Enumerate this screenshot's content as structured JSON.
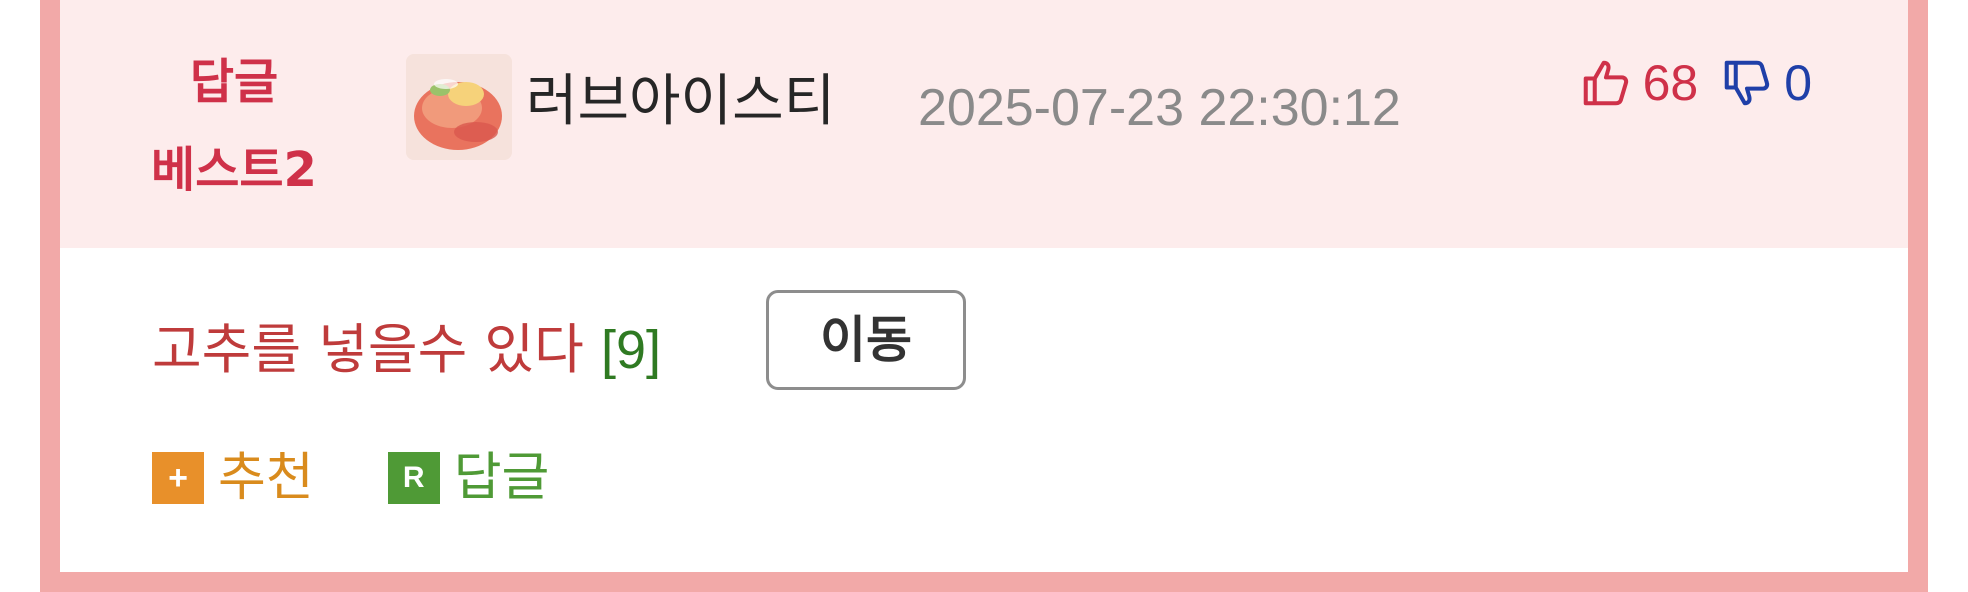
{
  "comment": {
    "best_label_line1": "답글",
    "best_label_line2": "베스트2",
    "nickname": "러브아이스티",
    "datetime": "2025-07-23 22:30:12",
    "upvotes": "68",
    "downvotes": "0",
    "text": "고추를 넣을수 있다",
    "reply_count": "[9]",
    "move_button": "이동",
    "recommend_badge": "+",
    "recommend_label": "추천",
    "reply_badge": "R",
    "reply_label": "답글"
  },
  "colors": {
    "frame": "#f2a9a8",
    "header_bg": "#fdecec",
    "best_label": "#cf3149",
    "comment_text": "#bf3b3b",
    "reply_count": "#2f7a22",
    "recommend": "#e8902a",
    "reply": "#4f9a36",
    "upvote": "#cf3149",
    "downvote": "#1f3fa8"
  },
  "icons": [
    "thumbs-up-icon",
    "thumbs-down-icon",
    "plus-icon",
    "reply-icon",
    "avatar-image"
  ]
}
